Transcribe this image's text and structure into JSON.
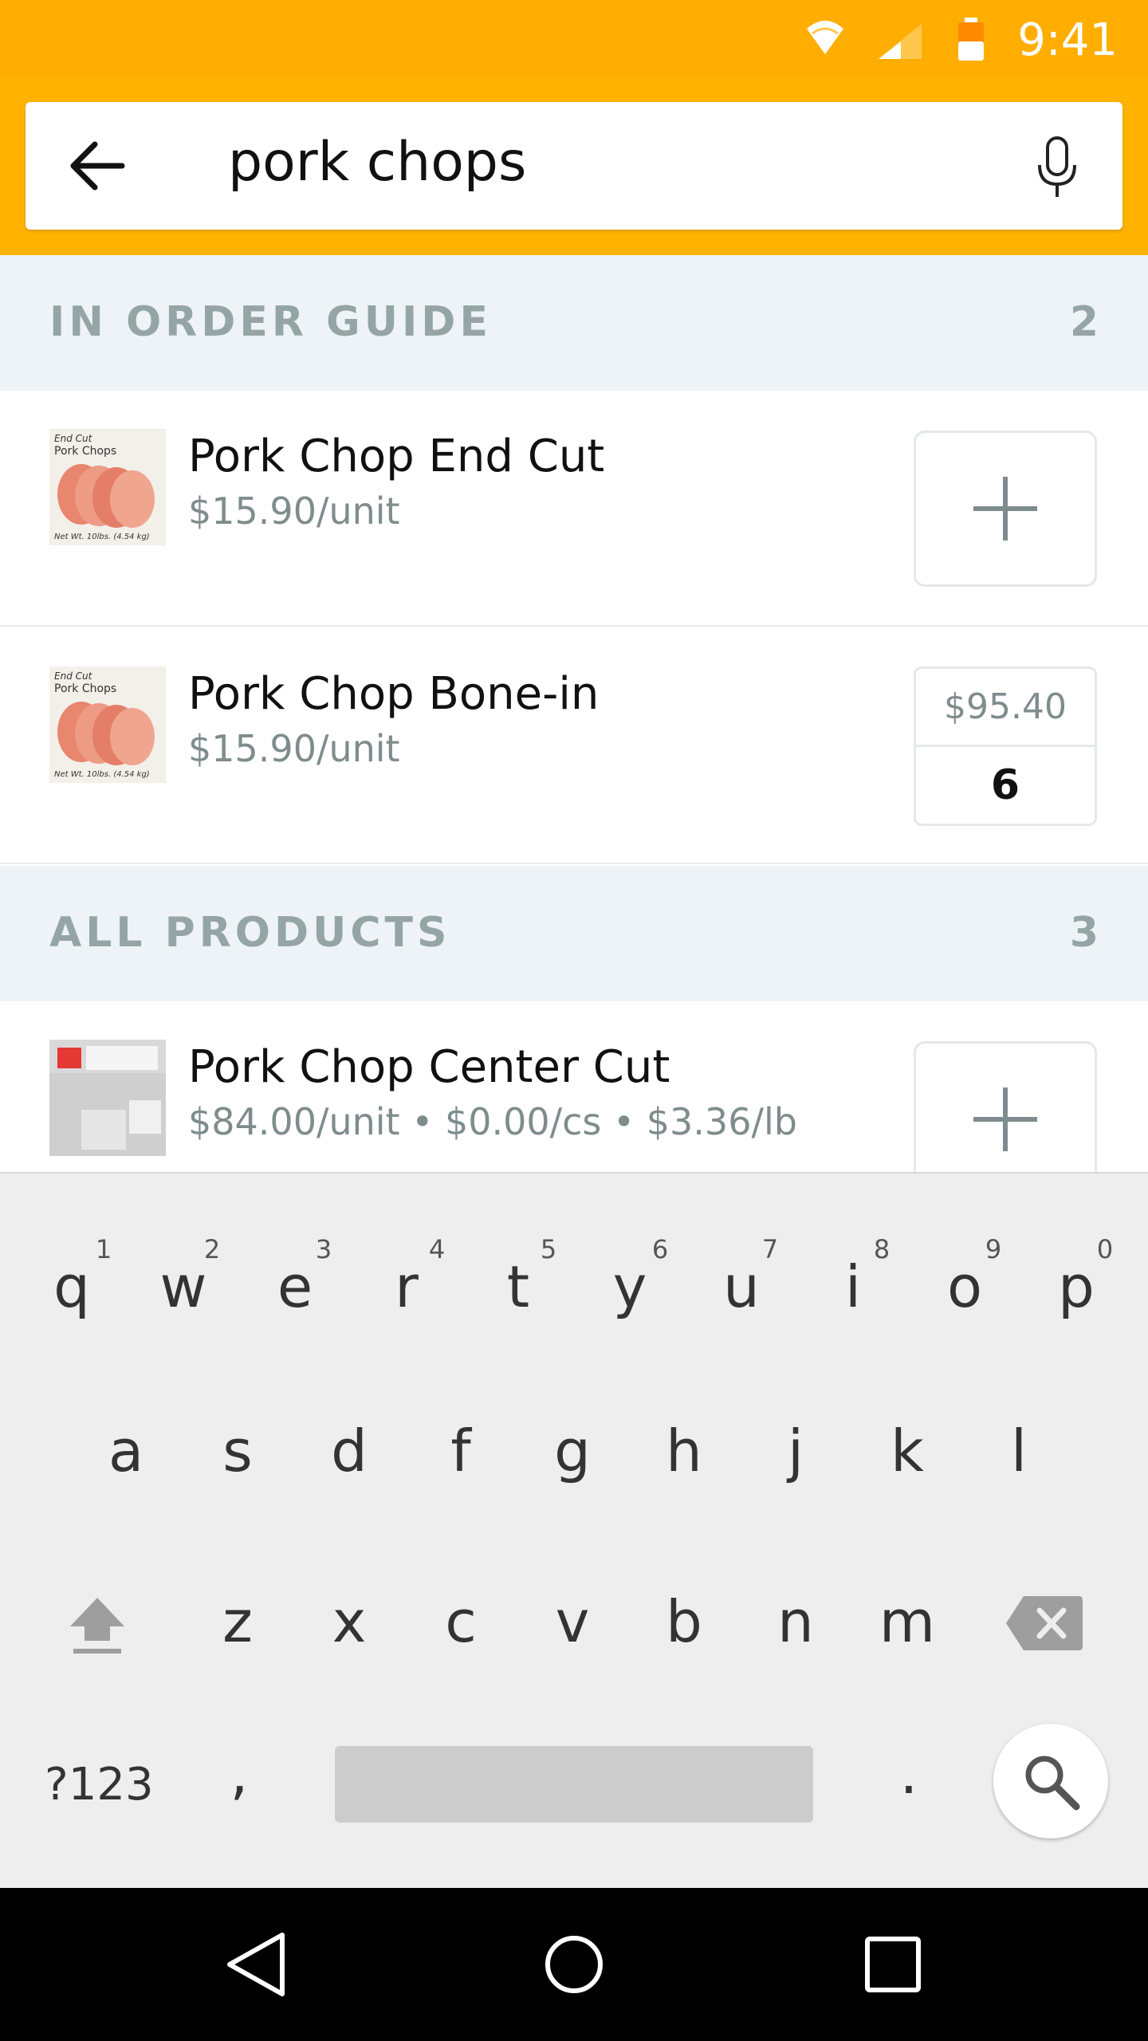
{
  "status_bar": {
    "time": "9:41",
    "icons": [
      "wifi-icon",
      "cell-signal-icon",
      "battery-icon"
    ]
  },
  "search": {
    "query": "pork chops",
    "back_icon": "arrow-left-icon",
    "mic_icon": "microphone-icon"
  },
  "order_guide": {
    "title": "IN ORDER GUIDE",
    "count": "2",
    "items": [
      {
        "name": "Pork Chop End Cut",
        "price": "$15.90/unit",
        "action": "add",
        "thumb_label_top": "End Cut",
        "thumb_label_mid": "Pork Chops",
        "thumb_label_bottom": "Net Wt. 10lbs. (4.54 kg)"
      },
      {
        "name": "Pork Chop Bone-in",
        "price": "$15.90/unit",
        "total": "$95.40",
        "quantity": "6",
        "thumb_label_top": "End Cut",
        "thumb_label_mid": "Pork Chops",
        "thumb_label_bottom": "Net Wt. 10lbs. (4.54 kg)"
      }
    ]
  },
  "all_products": {
    "title": "ALL PRODUCTS",
    "count": "3",
    "items": [
      {
        "name": "Pork Chop Center Cut",
        "price": "$84.00/unit • $0.00/cs • $3.36/lb",
        "action": "add"
      }
    ]
  },
  "keyboard": {
    "row1": [
      "q",
      "w",
      "e",
      "r",
      "t",
      "y",
      "u",
      "i",
      "o",
      "p"
    ],
    "row1_hints": [
      "1",
      "2",
      "3",
      "4",
      "5",
      "6",
      "7",
      "8",
      "9",
      "0"
    ],
    "row2": [
      "a",
      "s",
      "d",
      "f",
      "g",
      "h",
      "j",
      "k",
      "l"
    ],
    "row3": [
      "z",
      "x",
      "c",
      "v",
      "b",
      "n",
      "m"
    ],
    "symbols_label": "?123",
    "comma": ",",
    "period": "."
  },
  "colors": {
    "status_bar": "#FFAE00",
    "header": "#FFB300",
    "section_bg": "#EEF3F7",
    "section_text": "#95A5A6",
    "secondary_text": "#7F8C8D"
  }
}
